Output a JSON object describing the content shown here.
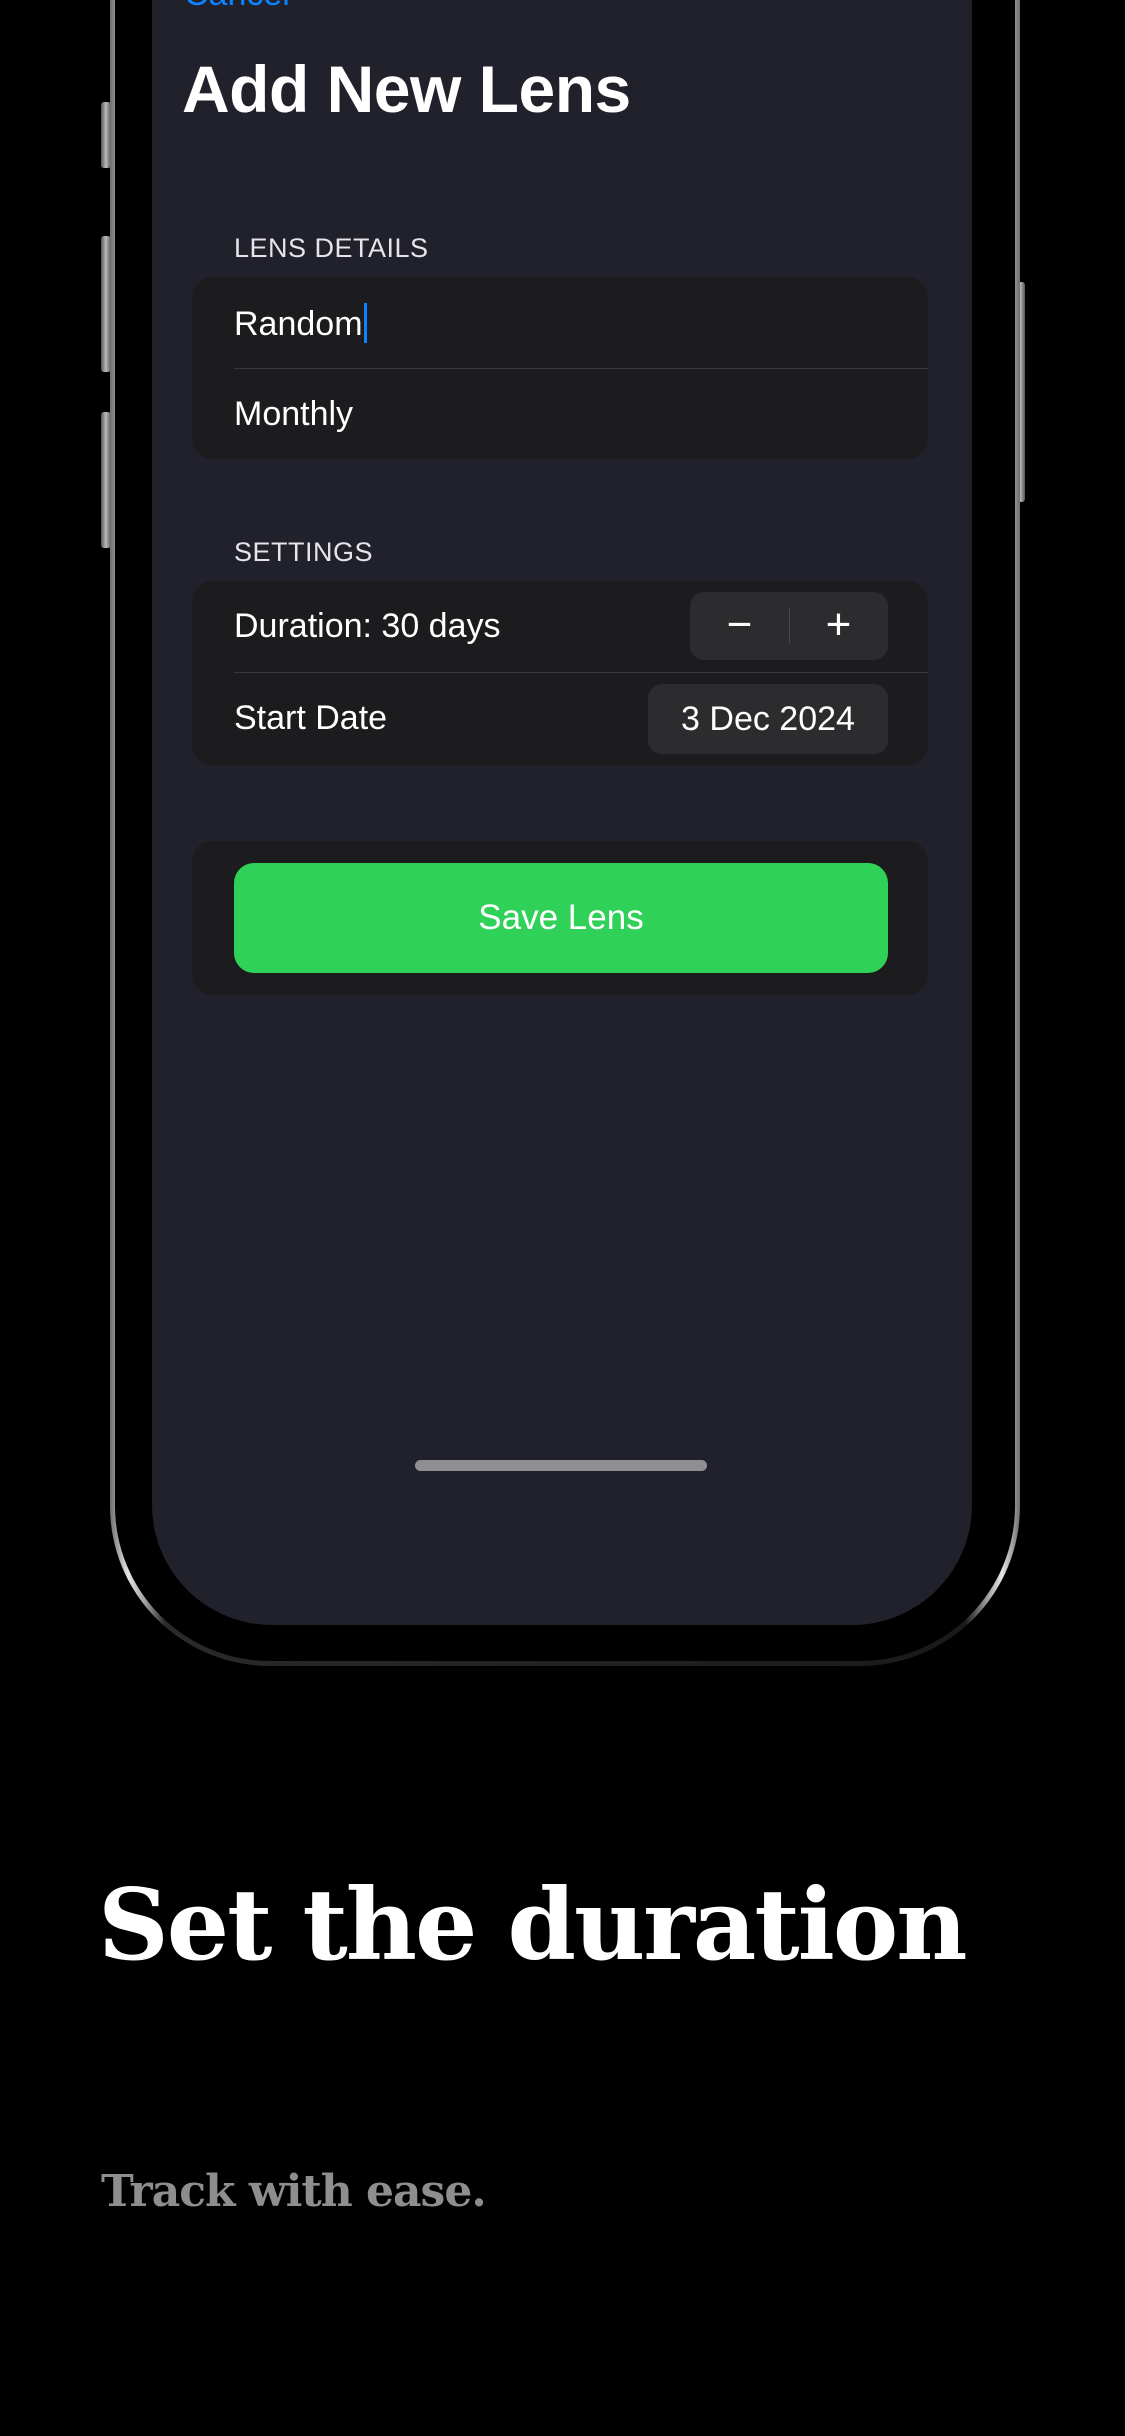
{
  "nav": {
    "cancel_label": "Cancel",
    "title": "Add New Lens"
  },
  "lens_details": {
    "header": "LENS DETAILS",
    "name_value": "Random",
    "type_value": "Monthly"
  },
  "settings": {
    "header": "SETTINGS",
    "duration_label": "Duration: 30 days",
    "decrement_glyph": "−",
    "increment_glyph": "+",
    "start_date_label": "Start Date",
    "start_date_value": "3 Dec 2024"
  },
  "actions": {
    "save_label": "Save Lens"
  },
  "caption": {
    "headline": "Set the duration",
    "subline": "Track with ease."
  },
  "colors": {
    "accent": "#0a84ff",
    "save_button": "#30d158",
    "screen_background": "#21212c",
    "group_background": "#1c1c1e"
  }
}
